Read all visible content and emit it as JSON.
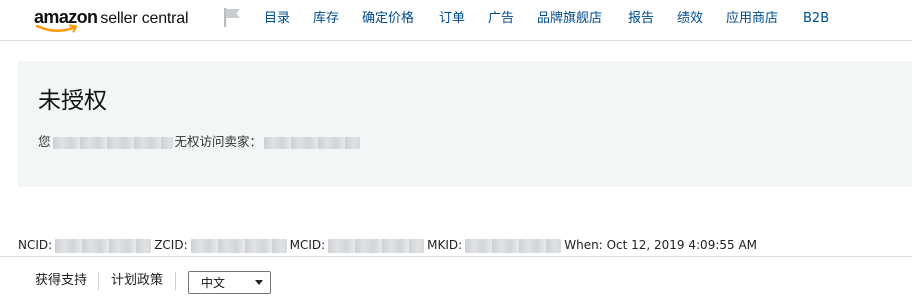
{
  "header": {
    "logo_brand": "amazon",
    "logo_product": "seller central",
    "flag_icon": "flag-icon",
    "nav": [
      {
        "id": "catalog",
        "label": "目录"
      },
      {
        "id": "inventory",
        "label": "库存"
      },
      {
        "id": "pricing",
        "label": "确定价格"
      },
      {
        "id": "orders",
        "label": "订单"
      },
      {
        "id": "advertising",
        "label": "广告"
      },
      {
        "id": "brand-stores",
        "label": "品牌旗舰店"
      },
      {
        "id": "reports",
        "label": "报告"
      },
      {
        "id": "performance",
        "label": "绩效"
      },
      {
        "id": "appstore",
        "label": "应用商店"
      },
      {
        "id": "b2b",
        "label": "B2B"
      }
    ]
  },
  "alert": {
    "title": "未授权",
    "msg_prefix": "您",
    "msg_middle": "无权访问卖家："
  },
  "ids": {
    "ncid_label": "NCID:",
    "zcid_label": "ZCID:",
    "mcid_label": "MCID:",
    "mkid_label": "MKID:",
    "when_label": "When:",
    "when_value": "Oct 12, 2019 4:09:55 AM"
  },
  "footer": {
    "support_label": "获得支持",
    "policies_label": "计划政策",
    "language_selected": "中文"
  },
  "colors": {
    "nav_link": "#004b91",
    "panel_bg": "#f2f6f7",
    "logo_smile": "#ff9900"
  }
}
